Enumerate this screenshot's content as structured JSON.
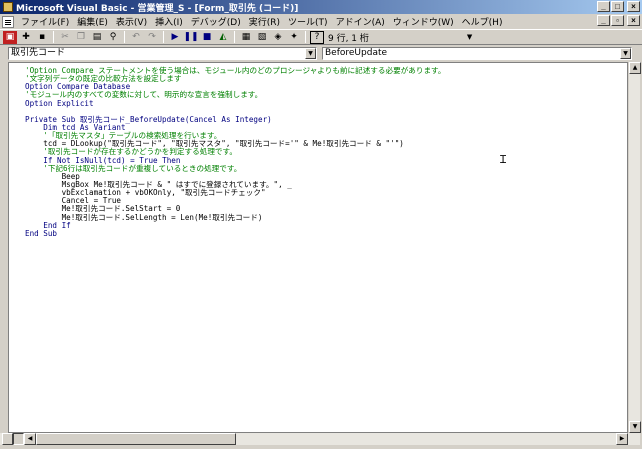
{
  "window": {
    "title": "Microsoft Visual Basic - 営業管理_S - [Form_取引先 (コード)]"
  },
  "menu": [
    "ファイル(F)",
    "編集(E)",
    "表示(V)",
    "挿入(I)",
    "デバッグ(D)",
    "実行(R)",
    "ツール(T)",
    "アドイン(A)",
    "ウィンドウ(W)",
    "ヘルプ(H)"
  ],
  "toolbar": {
    "position": "9 行, 1 桁"
  },
  "object_combo": {
    "value": "取引先コード"
  },
  "procedure_combo": {
    "value": "BeforeUpdate"
  },
  "code": [
    {
      "t": "c",
      "s": "'Option Compare ステートメントを使う場合は、モジュール内のどのプロシージャよりも前に記述する必要があります。"
    },
    {
      "t": "c",
      "s": "'文字列データの既定の比較方法を設定します"
    },
    {
      "t": "k",
      "s": "Option Compare Database"
    },
    {
      "t": "c",
      "s": "'モジュール内のすべての変数に対して、明示的な宣言を強制します。"
    },
    {
      "t": "k",
      "s": "Option Explicit"
    },
    {
      "t": "p",
      "s": ""
    },
    {
      "t": "k",
      "s": "Private Sub 取引先コード_BeforeUpdate(Cancel As Integer)"
    },
    {
      "t": "k",
      "s": "    Dim tcd As Variant"
    },
    {
      "t": "c",
      "s": "    '「取引先マスタ」テーブルの検索処理を行います。"
    },
    {
      "t": "p",
      "s": "    tcd = DLookup(\"取引先コード\", \"取引先マスタ\", \"取引先コード='\" & Me!取引先コード & \"'\")"
    },
    {
      "t": "c",
      "s": "    '取引先コードが存在するかどうかを判定する処理です。"
    },
    {
      "t": "k",
      "s": "    If Not IsNull(tcd) = True Then"
    },
    {
      "t": "c",
      "s": "    '下記6行は取引先コードが重複しているときの処理です。"
    },
    {
      "t": "p",
      "s": "        Beep"
    },
    {
      "t": "p",
      "s": "        MsgBox Me!取引先コード & \" はすでに登録されています。\", _"
    },
    {
      "t": "p",
      "s": "        vbExclamation + vbOKOnly, \"取引先コードチェック\""
    },
    {
      "t": "p",
      "s": "        Cancel = True"
    },
    {
      "t": "p",
      "s": "        Me!取引先コード.SelStart = 0"
    },
    {
      "t": "p",
      "s": "        Me!取引先コード.SelLength = Len(Me!取引先コード)"
    },
    {
      "t": "k",
      "s": "    End If"
    },
    {
      "t": "k",
      "s": "End Sub"
    }
  ]
}
